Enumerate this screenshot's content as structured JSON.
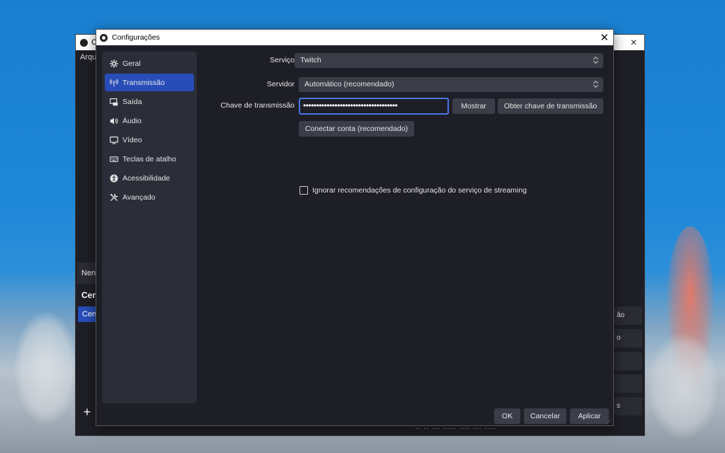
{
  "main_window": {
    "title_initial": "O",
    "menu_first": "Arqui",
    "nenhum_label": "Nenh",
    "scenes_header": "Cen",
    "scene_item": "Cena",
    "add_symbol": "+",
    "right_rows": [
      "ão",
      "o",
      "",
      "",
      "s",
      ""
    ],
    "status_text": "-- -- --- ----- ---- --- ----"
  },
  "dialog": {
    "title": "Configurações",
    "sidebar": {
      "items": [
        {
          "label": "Geral",
          "icon": "gear-icon"
        },
        {
          "label": "Transmissão",
          "icon": "broadcast-icon"
        },
        {
          "label": "Saída",
          "icon": "output-icon"
        },
        {
          "label": "Áudio",
          "icon": "speaker-icon"
        },
        {
          "label": "Vídeo",
          "icon": "monitor-icon"
        },
        {
          "label": "Teclas de atalho",
          "icon": "keyboard-icon"
        },
        {
          "label": "Acessibilidade",
          "icon": "accessibility-icon"
        },
        {
          "label": "Avançado",
          "icon": "tools-icon"
        }
      ],
      "active_index": 1
    },
    "form": {
      "service_label": "Serviço",
      "service_value": "Twitch",
      "server_label": "Servidor",
      "server_value": "Automático (recomendado)",
      "key_label": "Chave de transmissão",
      "key_value": "••••••••••••••••••••••••••••••••••••",
      "show_button": "Mostrar",
      "get_key_button": "Obter chave de transmissão",
      "connect_button": "Conectar conta (recomendado)",
      "ignore_checkbox_label": "Ignorar recomendações de configuração do serviço de streaming",
      "ignore_checked": false
    },
    "footer": {
      "ok": "OK",
      "cancel": "Cancelar",
      "apply": "Aplicar"
    }
  },
  "colors": {
    "accent": "#284cb8",
    "focus_border": "#4a74e8",
    "panel": "#2b2d38",
    "background": "#1e1f26",
    "control": "#3b3d48"
  }
}
